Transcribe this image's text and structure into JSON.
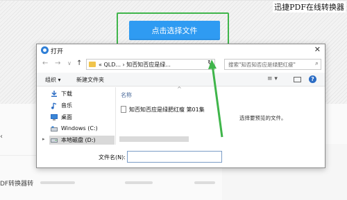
{
  "brand_text": "迅捷PDF在线转换器",
  "upload_button_label": "点击选择文件",
  "accent_color": "#2f9bf2",
  "highlight_color": "#3fb54a",
  "background_page": {
    "left_arrow": "‹",
    "bottom_text": "DF转换器转"
  },
  "dialog": {
    "title": "打开",
    "close_icon": "✕",
    "nav": {
      "back_icon": "←",
      "forward_icon": "→",
      "recent_icon": "∨",
      "up_icon": "↑",
      "address_path": "« QLD... › 知否知否应是绿...",
      "address_chevron": "∨",
      "refresh_icon": "↻",
      "search_placeholder": "搜索\"知否知否应是绿肥红瘦\"",
      "search_icon": "⌕"
    },
    "toolbar": {
      "organize_label": "组织 ▾",
      "new_folder_label": "新建文件夹",
      "view_icon": "≡ ▾",
      "help_icon": "?"
    },
    "sidebar": {
      "items": [
        {
          "label": "下载",
          "icon": "download-icon"
        },
        {
          "label": "音乐",
          "icon": "music-icon"
        },
        {
          "label": "桌面",
          "icon": "desktop-icon"
        },
        {
          "label": "Windows (C:)",
          "icon": "drive-icon"
        },
        {
          "label": "本地磁盘 (D:)",
          "icon": "drive-icon",
          "selected": true
        }
      ],
      "expand_icon": "▸"
    },
    "filelist": {
      "sort_up_icon": "^",
      "column_name": "名称",
      "files": [
        {
          "name": "知否知否应是绿肥红瘦 第01集"
        }
      ]
    },
    "preview_text": "选择要预览的文件。",
    "filename_label": "文件名(N):",
    "filename_value": ""
  }
}
